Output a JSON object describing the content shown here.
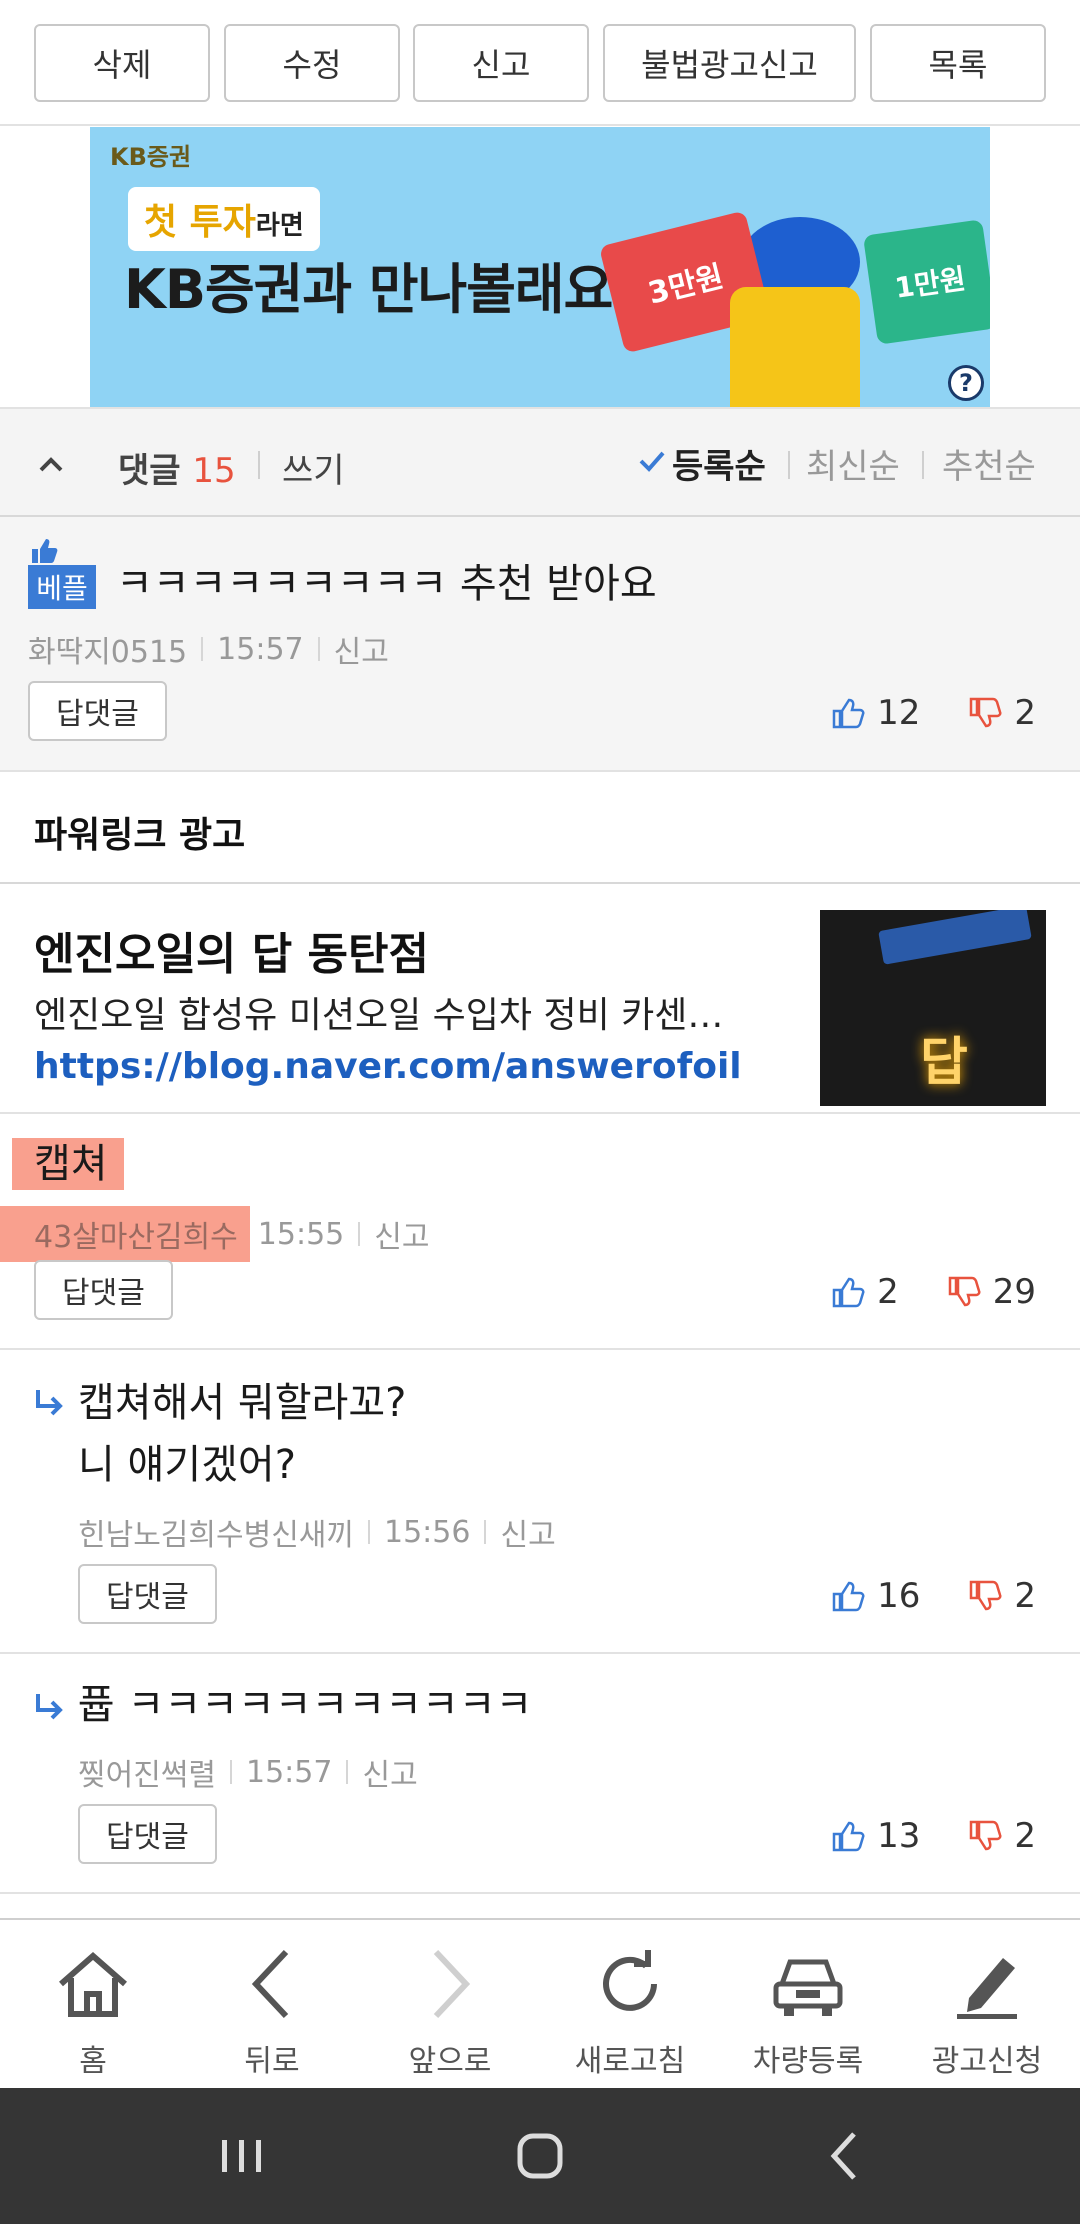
{
  "topbar": {
    "buttons": [
      "삭제",
      "수정",
      "신고",
      "불법광고신고",
      "목록"
    ]
  },
  "banner": {
    "brand": "KB증권",
    "tag_main": "첫 투자",
    "tag_small": "라면",
    "headline": "KB증권과 만나볼래요?",
    "card1": "3만원",
    "card2": "1만원",
    "help": "?"
  },
  "comments_header": {
    "label": "댓글",
    "count": "15",
    "write": "쓰기",
    "sort_options": [
      "등록순",
      "최신순",
      "추천순"
    ],
    "active_sort": "등록순"
  },
  "comments": [
    {
      "badge": "베플",
      "text": "ㅋㅋㅋㅋㅋㅋㅋㅋㅋ 추천 받아요",
      "author": "화딱지0515",
      "time": "15:57",
      "report": "신고",
      "reply_label": "답댓글",
      "up": "12",
      "down": "2"
    },
    {
      "text": "캡쳐",
      "author": "43살마산김희수",
      "time": "15:55",
      "report": "신고",
      "reply_label": "답댓글",
      "up": "2",
      "down": "29"
    },
    {
      "text_line1": "캡쳐해서 뭐할라꼬?",
      "text_line2": "니 얘기겠어?",
      "author": "힌남노김희수병신새끼",
      "time": "15:56",
      "report": "신고",
      "reply_label": "답댓글",
      "up": "16",
      "down": "2"
    },
    {
      "text": "퓹 ㅋㅋㅋㅋㅋㅋㅋㅋㅋㅋㅋ",
      "author": "찢어진썩렬",
      "time": "15:57",
      "report": "신고",
      "reply_label": "답댓글",
      "up": "13",
      "down": "2"
    }
  ],
  "powerlink": {
    "title": "파워링크 광고",
    "ad_title": "엔진오일의 답 동탄점",
    "ad_desc": "엔진오일 합성유 미션오일 수입차 정비 카센…",
    "ad_url": "https://blog.naver.com/answerofoil",
    "ad_image_text": "답"
  },
  "bottom_nav": [
    "홈",
    "뒤로",
    "앞으로",
    "새로고침",
    "차량등록",
    "광고신청"
  ],
  "colors": {
    "accent_blue": "#3a7bd5",
    "count_red": "#e8533e",
    "link_blue": "#1d5fbf",
    "highlight": "#f9a08e"
  }
}
